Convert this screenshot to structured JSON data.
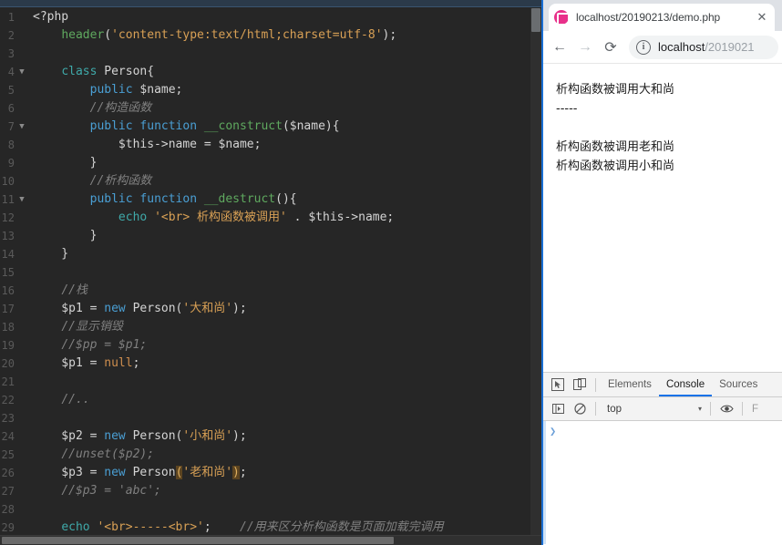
{
  "editor": {
    "language": "php",
    "theme_bg": "#262626",
    "lines": [
      {
        "n": "1",
        "fold": "",
        "tokens": [
          {
            "t": "<?php",
            "c": "ctext"
          }
        ]
      },
      {
        "n": "2",
        "fold": "",
        "tokens": [
          {
            "t": "    ",
            "c": "ctext"
          },
          {
            "t": "header",
            "c": "fn"
          },
          {
            "t": "(",
            "c": "punc"
          },
          {
            "t": "'content-type:text/html;charset=utf-8'",
            "c": "str"
          },
          {
            "t": ");",
            "c": "punc"
          }
        ]
      },
      {
        "n": "3",
        "fold": "",
        "tokens": []
      },
      {
        "n": "4",
        "fold": "▼",
        "tokens": [
          {
            "t": "    ",
            "c": "ctext"
          },
          {
            "t": "class",
            "c": "kw2"
          },
          {
            "t": " Person{",
            "c": "ctext"
          }
        ]
      },
      {
        "n": "5",
        "fold": "",
        "tokens": [
          {
            "t": "        ",
            "c": "ctext"
          },
          {
            "t": "public",
            "c": "kw"
          },
          {
            "t": " $name;",
            "c": "ctext"
          }
        ]
      },
      {
        "n": "6",
        "fold": "",
        "tokens": [
          {
            "t": "        ",
            "c": "ctext"
          },
          {
            "t": "//构造函数",
            "c": "cmt"
          }
        ]
      },
      {
        "n": "7",
        "fold": "▼",
        "tokens": [
          {
            "t": "        ",
            "c": "ctext"
          },
          {
            "t": "public function",
            "c": "kw"
          },
          {
            "t": " ",
            "c": "ctext"
          },
          {
            "t": "__construct",
            "c": "fn"
          },
          {
            "t": "($name){",
            "c": "ctext"
          }
        ]
      },
      {
        "n": "8",
        "fold": "",
        "tokens": [
          {
            "t": "            $this->name = $name;",
            "c": "ctext"
          }
        ]
      },
      {
        "n": "9",
        "fold": "",
        "tokens": [
          {
            "t": "        }",
            "c": "ctext"
          }
        ]
      },
      {
        "n": "10",
        "fold": "",
        "tokens": [
          {
            "t": "        ",
            "c": "ctext"
          },
          {
            "t": "//析构函数",
            "c": "cmt"
          }
        ]
      },
      {
        "n": "11",
        "fold": "▼",
        "tokens": [
          {
            "t": "        ",
            "c": "ctext"
          },
          {
            "t": "public function",
            "c": "kw"
          },
          {
            "t": " ",
            "c": "ctext"
          },
          {
            "t": "__destruct",
            "c": "fn"
          },
          {
            "t": "(){",
            "c": "ctext"
          }
        ]
      },
      {
        "n": "12",
        "fold": "",
        "tokens": [
          {
            "t": "            ",
            "c": "ctext"
          },
          {
            "t": "echo",
            "c": "kw2"
          },
          {
            "t": " ",
            "c": "ctext"
          },
          {
            "t": "'<br> 析构函数被调用'",
            "c": "str"
          },
          {
            "t": " . $this->name;",
            "c": "ctext"
          }
        ]
      },
      {
        "n": "13",
        "fold": "",
        "tokens": [
          {
            "t": "        }",
            "c": "ctext"
          }
        ]
      },
      {
        "n": "14",
        "fold": "",
        "tokens": [
          {
            "t": "    }",
            "c": "ctext"
          }
        ]
      },
      {
        "n": "15",
        "fold": "",
        "tokens": []
      },
      {
        "n": "16",
        "fold": "",
        "tokens": [
          {
            "t": "    ",
            "c": "ctext"
          },
          {
            "t": "//栈",
            "c": "cmt"
          }
        ]
      },
      {
        "n": "17",
        "fold": "",
        "tokens": [
          {
            "t": "    $p1 = ",
            "c": "ctext"
          },
          {
            "t": "new",
            "c": "kw"
          },
          {
            "t": " Person(",
            "c": "ctext"
          },
          {
            "t": "'大和尚'",
            "c": "str"
          },
          {
            "t": ");",
            "c": "ctext"
          }
        ]
      },
      {
        "n": "18",
        "fold": "",
        "tokens": [
          {
            "t": "    ",
            "c": "ctext"
          },
          {
            "t": "//显示销毁",
            "c": "cmt"
          }
        ]
      },
      {
        "n": "19",
        "fold": "",
        "tokens": [
          {
            "t": "    ",
            "c": "ctext"
          },
          {
            "t": "//$pp = $p1;",
            "c": "cmt"
          }
        ]
      },
      {
        "n": "20",
        "fold": "",
        "tokens": [
          {
            "t": "    $p1 = ",
            "c": "ctext"
          },
          {
            "t": "null",
            "c": "orange"
          },
          {
            "t": ";",
            "c": "ctext"
          }
        ]
      },
      {
        "n": "21",
        "fold": "",
        "tokens": []
      },
      {
        "n": "22",
        "fold": "",
        "tokens": [
          {
            "t": "    ",
            "c": "ctext"
          },
          {
            "t": "//..",
            "c": "cmt"
          }
        ]
      },
      {
        "n": "23",
        "fold": "",
        "tokens": []
      },
      {
        "n": "24",
        "fold": "",
        "tokens": [
          {
            "t": "    $p2 = ",
            "c": "ctext"
          },
          {
            "t": "new",
            "c": "kw"
          },
          {
            "t": " Person(",
            "c": "ctext"
          },
          {
            "t": "'小和尚'",
            "c": "str"
          },
          {
            "t": ");",
            "c": "ctext"
          }
        ]
      },
      {
        "n": "25",
        "fold": "",
        "tokens": [
          {
            "t": "    ",
            "c": "ctext"
          },
          {
            "t": "//unset($p2);",
            "c": "cmt"
          }
        ]
      },
      {
        "n": "26",
        "fold": "",
        "tokens": [
          {
            "t": "    $p3 = ",
            "c": "ctext"
          },
          {
            "t": "new",
            "c": "kw"
          },
          {
            "t": " Person",
            "c": "ctext"
          },
          {
            "t": "(",
            "c": "bracket-hl"
          },
          {
            "t": "'老和尚'",
            "c": "str"
          },
          {
            "t": ")",
            "c": "bracket-hl"
          },
          {
            "t": ";",
            "c": "ctext"
          }
        ]
      },
      {
        "n": "27",
        "fold": "",
        "tokens": [
          {
            "t": "    ",
            "c": "ctext"
          },
          {
            "t": "//$p3 = 'abc';",
            "c": "cmt"
          }
        ]
      },
      {
        "n": "28",
        "fold": "",
        "tokens": []
      },
      {
        "n": "29",
        "fold": "",
        "tokens": [
          {
            "t": "    ",
            "c": "ctext"
          },
          {
            "t": "echo",
            "c": "kw2"
          },
          {
            "t": " ",
            "c": "ctext"
          },
          {
            "t": "'<br>-----<br>'",
            "c": "str"
          },
          {
            "t": ";    ",
            "c": "ctext"
          },
          {
            "t": "//用来区分析构函数是页面加载完调用",
            "c": "cmt"
          }
        ]
      }
    ]
  },
  "browser": {
    "tab": {
      "title": "localhost/20190213/demo.php",
      "favicon_name": "wamp-icon",
      "favicon_color": "#e8308a",
      "close_label": "✕"
    },
    "toolbar": {
      "back_label": "←",
      "forward_label": "→",
      "reload_label": "⟳",
      "info_label": "i",
      "url_host": "localhost",
      "url_path": "/2019021"
    },
    "page_output": [
      "析构函数被调用大和尚",
      "-----",
      "",
      "析构函数被调用老和尚",
      "析构函数被调用小和尚"
    ]
  },
  "devtools": {
    "tabs": [
      {
        "label": "Elements",
        "active": false
      },
      {
        "label": "Console",
        "active": true
      },
      {
        "label": "Sources",
        "active": false
      }
    ],
    "inspect_icon": "▣",
    "device_icon": "▯",
    "console": {
      "sidebar_icon": "▶",
      "clear_icon": "⃠",
      "context": "top",
      "context_caret": "▾",
      "eye_icon": "◉",
      "filter_placeholder": "F",
      "prompt": "❯"
    }
  }
}
